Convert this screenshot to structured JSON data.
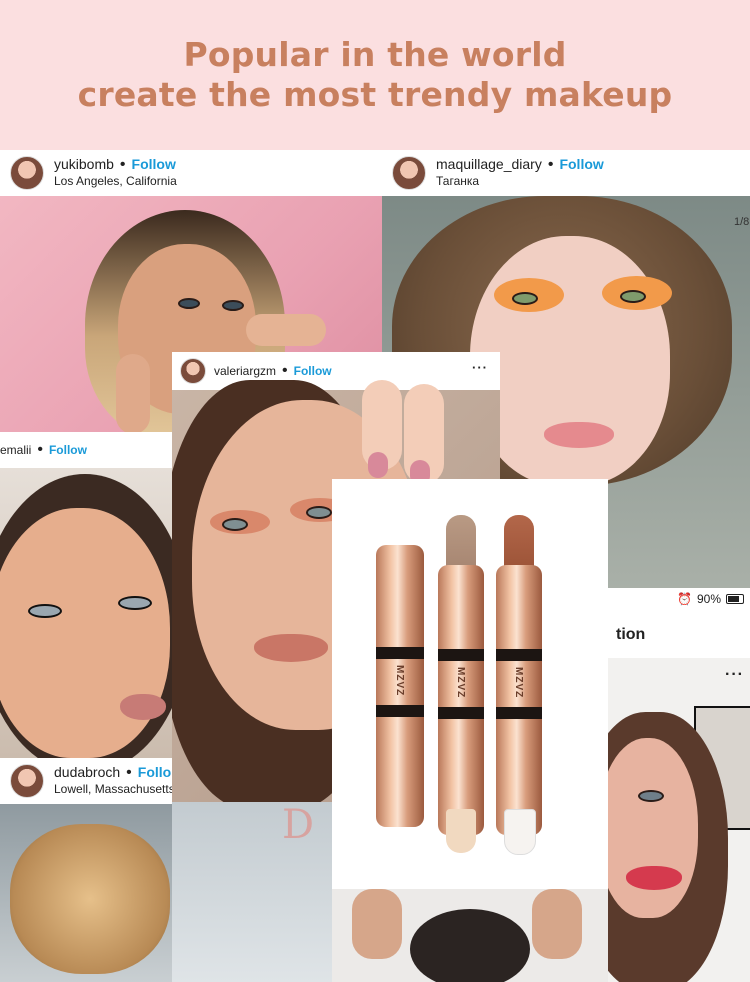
{
  "banner": {
    "line1": "Popular in the world",
    "line2": "create the most trendy makeup",
    "color": "#c8805f",
    "background": "#fbdfe0"
  },
  "posts": [
    {
      "username": "yukibomb",
      "follow": "Follow",
      "location": "Los Angeles, California"
    },
    {
      "username": "maquillage_diary",
      "follow": "Follow",
      "location": "Таганка"
    },
    {
      "username": "emalii",
      "follow": "Follow",
      "location": ""
    },
    {
      "username": "valeriargzm",
      "follow": "Follow",
      "location": ""
    },
    {
      "username": "dudabroch",
      "follow": "Follo",
      "location": "Lowell, Massachusetts"
    }
  ],
  "post_right": {
    "title_fragment": "tion",
    "more": "···"
  },
  "status_bar": {
    "battery": "90%"
  },
  "photo_counter": "1/8",
  "product": {
    "brand": "MZVZ"
  },
  "icons": [
    "more-dots-icon",
    "battery-icon",
    "alarm-icon"
  ]
}
